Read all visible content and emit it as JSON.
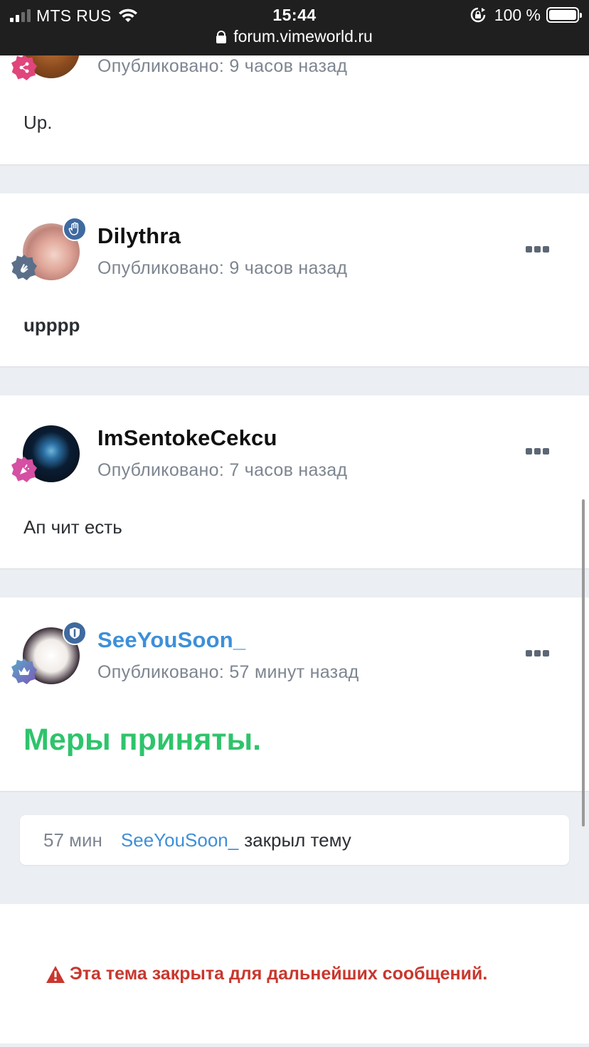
{
  "status_bar": {
    "carrier": "MTS RUS",
    "time": "15:44",
    "battery": "100 %",
    "url": "forum.vimeworld.ru"
  },
  "posts": [
    {
      "username": "",
      "posted": "Опубликовано: 9 часов назад",
      "content": "Up.",
      "rank_color": "#e0457b"
    },
    {
      "username": "Dilythra",
      "posted": "Опубликовано: 9 часов назад",
      "content": "upppp",
      "rank_color": "#5b6f8a",
      "role_color": "#3f6aa0"
    },
    {
      "username": "ImSentokeCekcu",
      "posted": "Опубликовано: 7 часов назад",
      "content": "Ап чит есть",
      "rank_color": "#d54fa3"
    },
    {
      "username": "SeeYouSoon_",
      "posted": "Опубликовано: 57 минут назад",
      "content": "Меры приняты.",
      "rank_color": "#6f63b8",
      "role_color": "#3f6aa0",
      "content_color": "#2ec46b"
    }
  ],
  "event": {
    "time": "57 мин",
    "user": "SeeYouSoon_",
    "text": "закрыл тему"
  },
  "closed_notice": "Эта тема закрыта для дальнейших сообщений.",
  "colors": {
    "link_blue": "#3d8fd9",
    "muted": "#7d8590",
    "danger": "#c8372d",
    "success": "#2ec46b",
    "page_bg": "#ebeef2"
  }
}
